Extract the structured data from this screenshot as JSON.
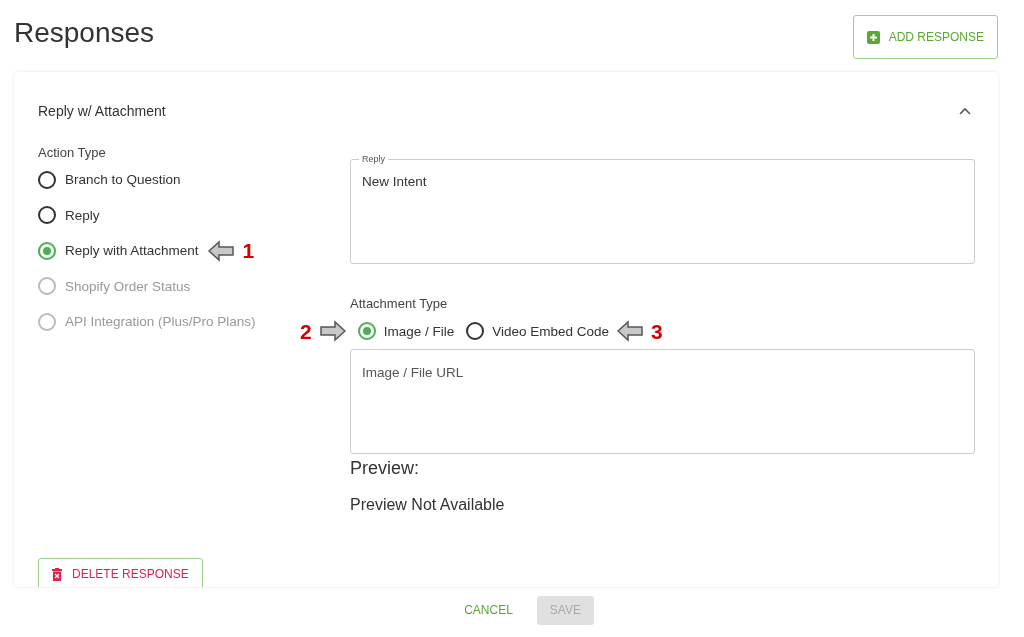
{
  "page": {
    "title": "Responses",
    "add_button": "ADD RESPONSE"
  },
  "card": {
    "title": "Reply w/ Attachment",
    "expanded": true,
    "action_type": {
      "label": "Action Type",
      "options": [
        {
          "label": "Branch to Question",
          "selected": false,
          "disabled": false
        },
        {
          "label": "Reply",
          "selected": false,
          "disabled": false
        },
        {
          "label": "Reply with Attachment",
          "selected": true,
          "disabled": false,
          "callout": {
            "number": "1",
            "kind": "left"
          }
        },
        {
          "label": "Shopify Order Status",
          "selected": false,
          "disabled": true
        },
        {
          "label": "API Integration (Plus/Pro Plans)",
          "selected": false,
          "disabled": true
        }
      ]
    },
    "reply_field": {
      "label": "Reply",
      "value": "New Intent"
    },
    "attachment_type": {
      "label": "Attachment Type",
      "options": [
        {
          "label": "Image / File",
          "selected": true,
          "callout": {
            "number": "2",
            "kind": "right"
          }
        },
        {
          "label": "Video Embed Code",
          "selected": false,
          "callout": {
            "number": "3",
            "kind": "left"
          }
        }
      ]
    },
    "url_field": {
      "placeholder": "Image / File URL"
    },
    "preview": {
      "heading": "Preview:",
      "message": "Preview Not Available"
    },
    "delete_button": "DELETE RESPONSE"
  },
  "footer": {
    "cancel": "CANCEL",
    "save": "SAVE",
    "save_disabled": true
  }
}
